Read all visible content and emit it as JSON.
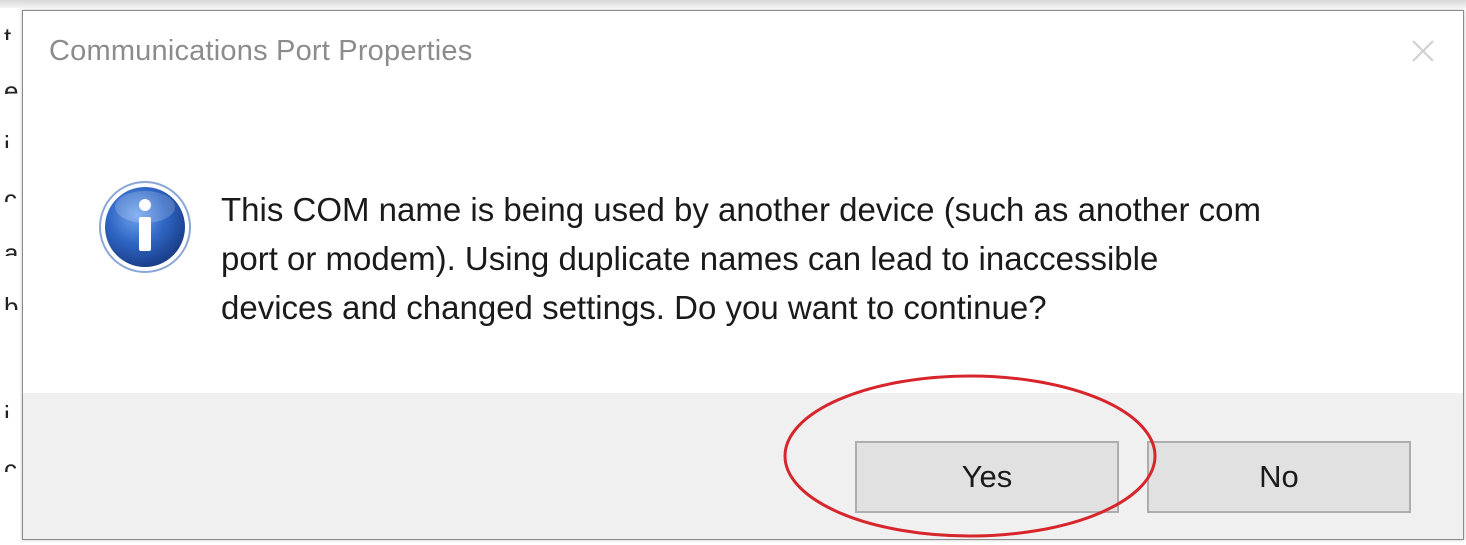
{
  "dialog": {
    "title": "Communications Port Properties",
    "close_icon": "close-icon",
    "info_icon": "info-icon",
    "message_lines": [
      "This COM name is being used by another device (such as another com",
      "port or modem).  Using duplicate names can lead to inaccessible",
      "devices and changed settings.  Do you want to continue?"
    ],
    "buttons": {
      "yes_label": "Yes",
      "no_label": "No"
    }
  },
  "annotation": {
    "highlight_color": "#d7262b",
    "target": "Yes"
  },
  "colors": {
    "title_text": "#8c8c8c",
    "footer_bg": "#f0f0f0",
    "button_bg": "#e1e1e1",
    "info_icon_blue": "#2f66c4"
  }
}
